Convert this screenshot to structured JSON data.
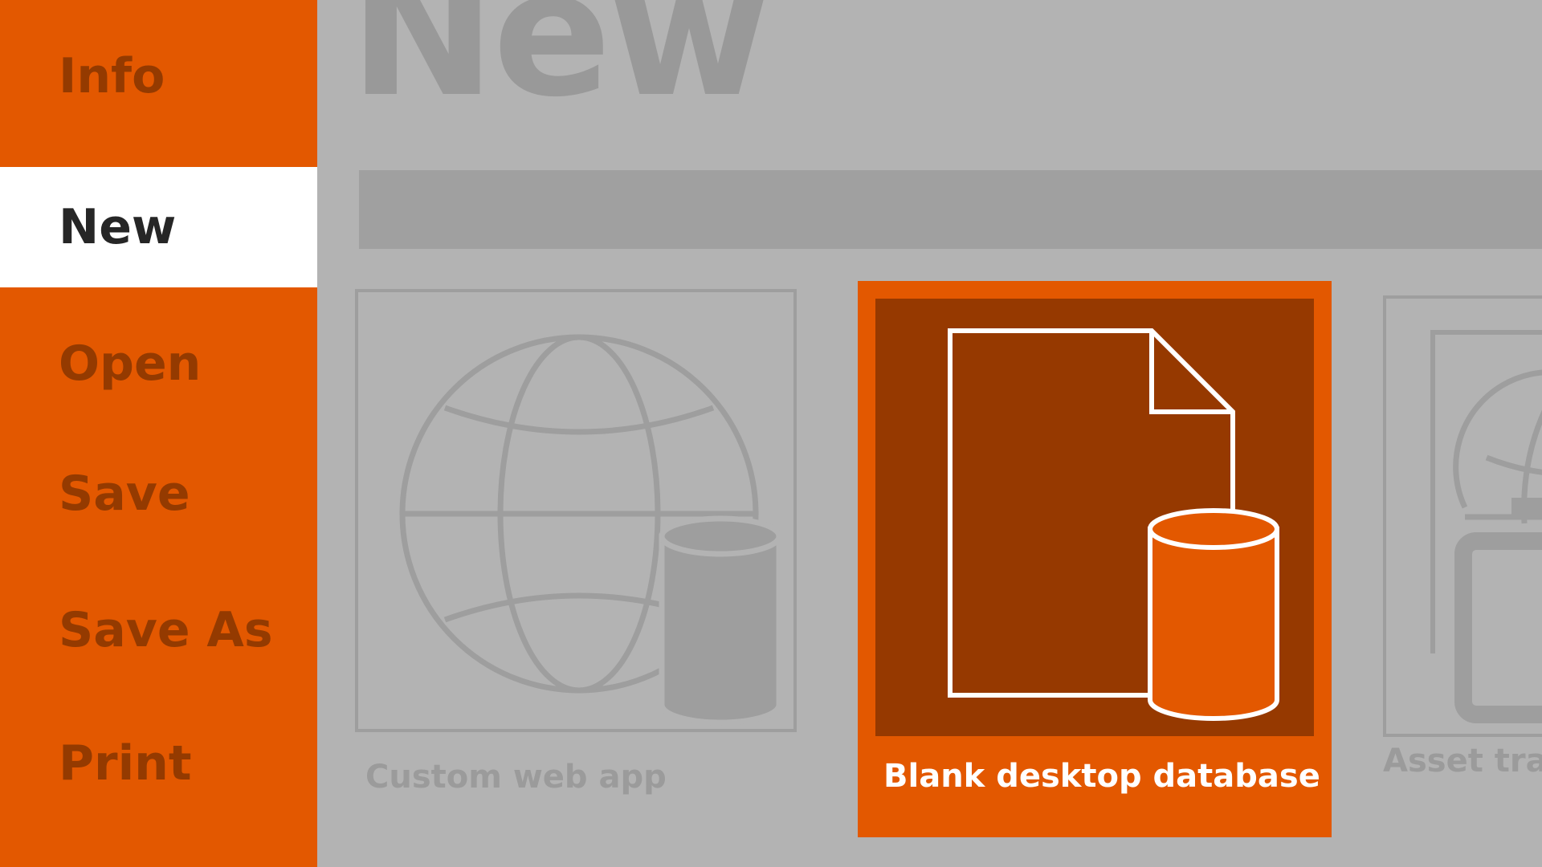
{
  "sidebar": {
    "items": [
      {
        "label": "Info",
        "active": false
      },
      {
        "label": "New",
        "active": true
      },
      {
        "label": "Open",
        "active": false
      },
      {
        "label": "Save",
        "active": false
      },
      {
        "label": "Save As",
        "active": false
      },
      {
        "label": "Print",
        "active": false
      }
    ]
  },
  "main": {
    "title": "New",
    "search": {
      "value": "",
      "placeholder": ""
    },
    "templates": [
      {
        "label": "Custom web app",
        "icon": "globe-database-icon",
        "selected": false
      },
      {
        "label": "Blank desktop database",
        "icon": "document-database-icon",
        "selected": true
      },
      {
        "label": "Asset trac",
        "icon": "asset-tracking-icon",
        "selected": false
      }
    ]
  },
  "colors": {
    "accent": "#e35800",
    "accent_dark": "#963900",
    "background": "#b3b3b3",
    "selected_nav_bg": "#ffffff"
  }
}
